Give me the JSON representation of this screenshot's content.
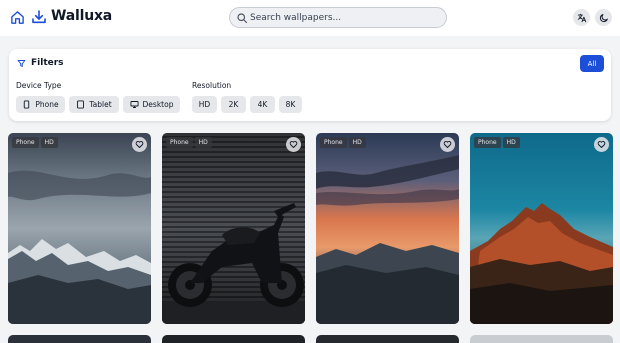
{
  "header": {
    "brand": "Walluxa",
    "search_placeholder": "Search wallpapers..."
  },
  "filters": {
    "title": "Filters",
    "all_label": "All",
    "device_type": {
      "label": "Device Type",
      "options": [
        "Phone",
        "Tablet",
        "Desktop"
      ]
    },
    "resolution": {
      "label": "Resolution",
      "options": [
        "HD",
        "2K",
        "4K",
        "8K"
      ]
    }
  },
  "wallpapers": [
    {
      "device": "Phone",
      "resolution": "HD",
      "scene": "snowy mountains under cloudy sky"
    },
    {
      "device": "Phone",
      "resolution": "HD",
      "scene": "motorcycle in front of metal shutter"
    },
    {
      "device": "Phone",
      "resolution": "HD",
      "scene": "orange sunset clouds over hills"
    },
    {
      "device": "Phone",
      "resolution": "HD",
      "scene": "red rocky mountain peak under blue sky"
    }
  ],
  "colors": {
    "accent": "#1d4ed8",
    "brand_icon": "#1d4ed8",
    "page_bg": "#f3f4f6"
  }
}
